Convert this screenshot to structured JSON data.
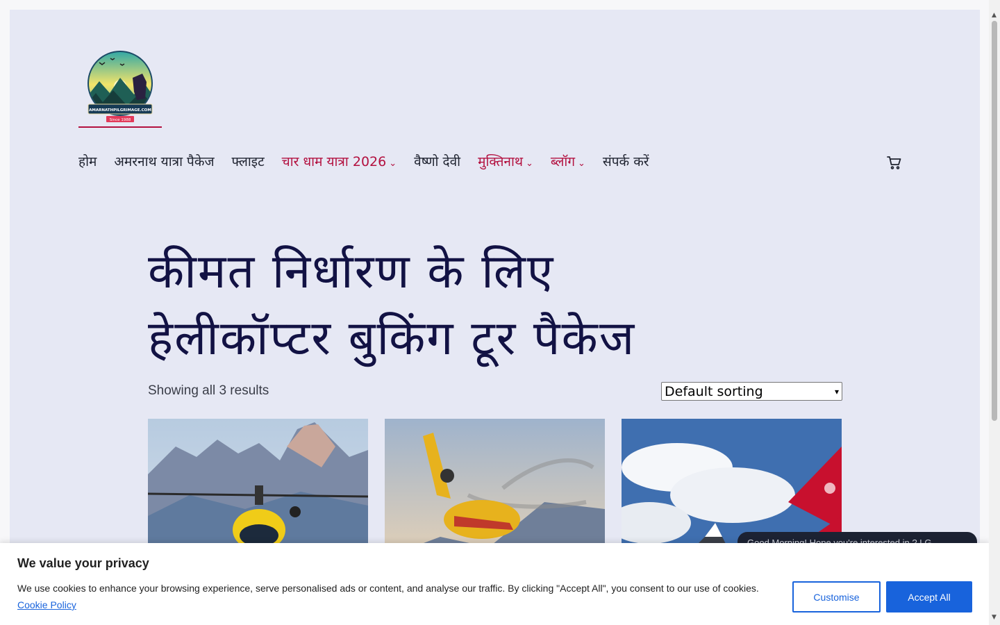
{
  "nav": {
    "items": [
      {
        "label": "होम",
        "accent": false,
        "dropdown": false
      },
      {
        "label": "अमरनाथ यात्रा पैकेज",
        "accent": false,
        "dropdown": false
      },
      {
        "label": "फ्लाइट",
        "accent": false,
        "dropdown": false
      },
      {
        "label": "चार धाम यात्रा 2026",
        "accent": true,
        "dropdown": true
      },
      {
        "label": "वैष्णो देवी",
        "accent": false,
        "dropdown": false
      },
      {
        "label": "मुक्तिनाथ",
        "accent": true,
        "dropdown": true
      },
      {
        "label": "ब्लॉग",
        "accent": true,
        "dropdown": true
      },
      {
        "label": "संपर्क करें",
        "accent": false,
        "dropdown": false
      }
    ],
    "chevron": "⌄"
  },
  "logo": {
    "text": "AMARNATHPILGRIMAGE.COM",
    "since": "Since 1988"
  },
  "page_title": {
    "line1": "कीमत निर्धारण के लिए",
    "line2": "हेलीकॉप्टर बुकिंग टूर पैकेज"
  },
  "results_text": "Showing all 3 results",
  "sort": {
    "selected": "Default sorting"
  },
  "chat": {
    "text": "Good Morning! Hope you're interested in ? I G..."
  },
  "cookie": {
    "title": "We value your privacy",
    "text": "We use cookies to enhance your browsing experience, serve personalised ads or content, and analyse our traffic. By clicking \"Accept All\", you consent to our use of cookies.",
    "link": "Cookie Policy",
    "customise": "Customise",
    "accept": "Accept All"
  },
  "colors": {
    "accent": "#b3103f",
    "page_bg": "#e6e8f4",
    "title": "#121244",
    "button_blue": "#1863dc"
  }
}
